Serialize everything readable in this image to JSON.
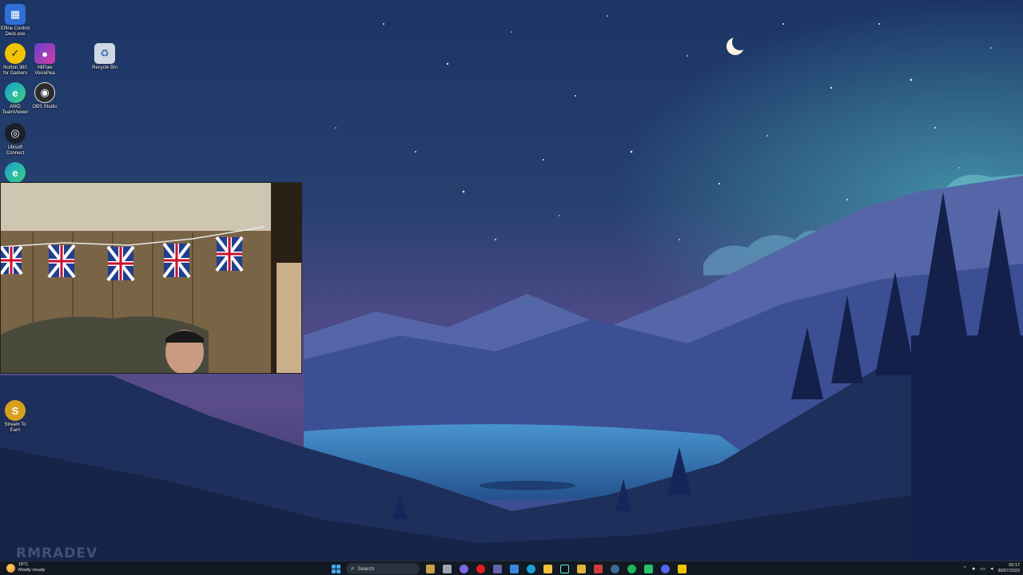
{
  "desktop": {
    "icons": [
      {
        "label": "Elfine Control\nDeck.exe",
        "icon": "control-deck-icon",
        "color": "#2f6fd6",
        "glyph": "▦"
      },
      {
        "label": "Norton 360\nfor Gamers",
        "icon": "norton-icon",
        "color": "#f2c400",
        "glyph": "✓"
      },
      {
        "label": "HitPaw\nVoicePea",
        "icon": "hitpaw-icon",
        "color": "#6b3fd1",
        "glyph": "●"
      },
      {
        "label": "Recycle Bin",
        "icon": "recycle-bin-icon",
        "color": "#cfd8e3",
        "glyph": "♻"
      },
      {
        "label": "AWD\nTeamViewer",
        "icon": "edge-icon",
        "color": "#1a9fd8",
        "glyph": "e"
      },
      {
        "label": "OBS Studio",
        "icon": "obs-icon",
        "color": "#2b2b2b",
        "glyph": "◉"
      },
      {
        "label": "Ubisoft\nConnect",
        "icon": "ubisoft-icon",
        "color": "#1b1f2a",
        "glyph": "◎"
      },
      {
        "label": "",
        "icon": "edge-icon-2",
        "color": "#1a9fd8",
        "glyph": "e"
      },
      {
        "label": "Stream To\nEarn",
        "icon": "stream-to-earn-icon",
        "color": "#d6a21d",
        "glyph": "S"
      }
    ]
  },
  "watermark": "RMRADEV",
  "taskbar": {
    "weather_temp": "18°C",
    "weather_desc": "Mostly cloudy",
    "search_placeholder": "Search",
    "pinned": [
      {
        "name": "widgets-icon",
        "color": "#c8a24a"
      },
      {
        "name": "task-view-icon",
        "color": "#9aa6b2"
      },
      {
        "name": "copilot-icon",
        "color": "#7d66e8"
      },
      {
        "name": "youtube-icon",
        "color": "#e21e1e"
      },
      {
        "name": "teams-icon",
        "color": "#6264a7"
      },
      {
        "name": "store-icon",
        "color": "#3a86e0"
      },
      {
        "name": "edge-taskbar-icon",
        "color": "#1a9fd8"
      },
      {
        "name": "file-explorer-icon",
        "color": "#f3c23c"
      },
      {
        "name": "tiktok-icon",
        "color": "#111111"
      },
      {
        "name": "slack-icon",
        "color": "#e0b43a"
      },
      {
        "name": "tf-app-icon",
        "color": "#d23b3b"
      },
      {
        "name": "steam-icon",
        "color": "#3d6a96"
      },
      {
        "name": "spotify-icon",
        "color": "#1db954"
      },
      {
        "name": "green-app-icon",
        "color": "#25c26a"
      },
      {
        "name": "discord-icon",
        "color": "#5865f2"
      },
      {
        "name": "norton-taskbar-icon",
        "color": "#f2c400"
      }
    ],
    "time": "00:17",
    "date": "30/07/2023"
  }
}
